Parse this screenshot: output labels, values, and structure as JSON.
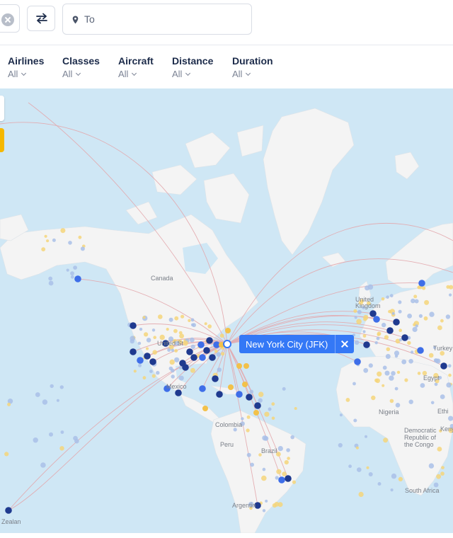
{
  "search": {
    "to_placeholder": "To"
  },
  "filters": [
    {
      "label": "Airlines",
      "value": "All"
    },
    {
      "label": "Classes",
      "value": "All"
    },
    {
      "label": "Aircraft",
      "value": "All"
    },
    {
      "label": "Distance",
      "value": "All"
    },
    {
      "label": "Duration",
      "value": "All"
    }
  ],
  "tooltip": {
    "text": "New York City (JFK)"
  },
  "map_labels": {
    "canada": "Canada",
    "united_states": "United St",
    "mexico": "Mexico",
    "colombia": "Colombia",
    "peru": "Peru",
    "brazil": "Brazil",
    "argentina": "Argentin",
    "nigeria": "Nigeria",
    "egypt": "Egypt",
    "ethiopia": "Ethi",
    "kenya": "Keny",
    "drc": "Democratic Republic of the Congo",
    "south_africa": "South Africa",
    "turkey": "Turkey",
    "uk": "United Kingdom",
    "new_zealand": "Zealan"
  },
  "colors": {
    "ocean": "#cfe7f5",
    "land": "#f4f4f4",
    "route": "#e3a8ad",
    "hub_dark": "#1f3a8f",
    "hub_blue": "#3e6ee8",
    "airport_light": "#a9bfe8",
    "airport_yellow": "#f4d57a",
    "accent": "#3478f6"
  },
  "icons": {
    "clear": "clear-icon",
    "swap": "swap-icon",
    "location": "location-pin-icon",
    "close": "close-icon"
  }
}
